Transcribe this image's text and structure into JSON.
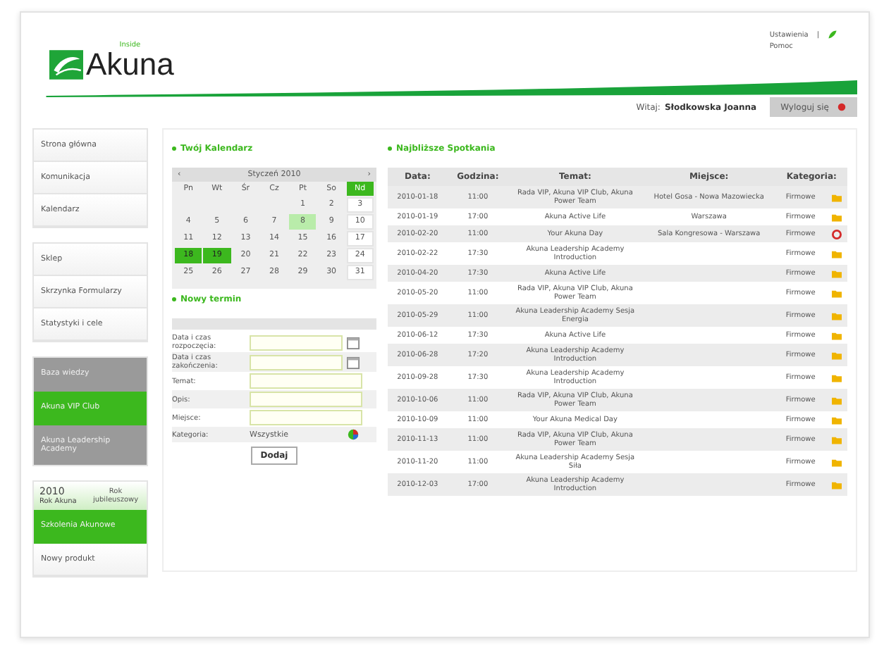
{
  "header": {
    "logo_small": "Inside",
    "logo": "Akuna",
    "links": [
      "Ustawienia",
      "|",
      "Pomoc"
    ],
    "welcome_label": "Witaj:",
    "user": "Słodkowska Joanna",
    "logout": "Wyloguj się"
  },
  "sidebar": {
    "groups": [
      {
        "kind": "plain",
        "items": [
          "Strona główna",
          "Komunikacja",
          "Kalendarz"
        ]
      },
      {
        "kind": "plain",
        "items": [
          "Sklep",
          "Skrzynka Formularzy",
          "Statystyki i cele"
        ]
      },
      {
        "kind": "tiles",
        "items": [
          {
            "label": "Baza wiedzy",
            "color": "#9a9a9a"
          },
          {
            "label": "Akuna VIP Club",
            "color": "#3cb81e"
          },
          {
            "label": "Akuna Leadership Academy",
            "color": "#9a9a9a"
          }
        ]
      }
    ],
    "banner": {
      "year": "2010",
      "brand": "Rok Akuna",
      "text": "Rok jubileuszowy"
    },
    "promo": "Szkolenia Akunowe",
    "last_item": "Nowy produkt"
  },
  "calendar": {
    "title": "Twój Kalendarz",
    "month": "Styczeń 2010",
    "prev": "‹",
    "next": "›",
    "weekdays": [
      {
        "label": "Pn",
        "selected": false
      },
      {
        "label": "Wt",
        "selected": false
      },
      {
        "label": "Śr",
        "selected": false
      },
      {
        "label": "Cz",
        "selected": false
      },
      {
        "label": "Pt",
        "selected": false
      },
      {
        "label": "So",
        "selected": false
      },
      {
        "label": "Nd",
        "selected": true
      }
    ],
    "weeks": [
      [
        {
          "kind": "empty"
        },
        {
          "kind": "empty"
        },
        {
          "kind": "empty"
        },
        {
          "kind": "empty"
        },
        {
          "day": "1",
          "kind": "day"
        },
        {
          "day": "2",
          "kind": "day"
        },
        {
          "day": "3",
          "kind": "sunday"
        }
      ],
      [
        {
          "day": "4",
          "kind": "day"
        },
        {
          "day": "5",
          "kind": "day"
        },
        {
          "day": "6",
          "kind": "day"
        },
        {
          "day": "7",
          "kind": "day"
        },
        {
          "day": "8",
          "kind": "today"
        },
        {
          "day": "9",
          "kind": "day"
        },
        {
          "day": "10",
          "kind": "sunday"
        }
      ],
      [
        {
          "day": "11",
          "kind": "day"
        },
        {
          "day": "12",
          "kind": "day"
        },
        {
          "day": "13",
          "kind": "day"
        },
        {
          "day": "14",
          "kind": "day"
        },
        {
          "day": "15",
          "kind": "day"
        },
        {
          "day": "16",
          "kind": "day"
        },
        {
          "day": "17",
          "kind": "sunday"
        }
      ],
      [
        {
          "day": "18",
          "kind": "event"
        },
        {
          "day": "19",
          "kind": "event"
        },
        {
          "day": "20",
          "kind": "day"
        },
        {
          "day": "21",
          "kind": "day"
        },
        {
          "day": "22",
          "kind": "day"
        },
        {
          "day": "23",
          "kind": "day"
        },
        {
          "day": "24",
          "kind": "sunday"
        }
      ],
      [
        {
          "day": "25",
          "kind": "day"
        },
        {
          "day": "26",
          "kind": "day"
        },
        {
          "day": "27",
          "kind": "day"
        },
        {
          "day": "28",
          "kind": "day"
        },
        {
          "day": "29",
          "kind": "day"
        },
        {
          "day": "30",
          "kind": "day"
        },
        {
          "day": "31",
          "kind": "sunday"
        }
      ]
    ]
  },
  "new_event": {
    "title": "Nowy termin",
    "fields": [
      {
        "label": "Data i czas rozpoczęcia:",
        "kind": "date"
      },
      {
        "label": "Data i czas zakończenia:",
        "kind": "date"
      },
      {
        "label": "Temat:",
        "kind": "text"
      },
      {
        "label": "Opis:",
        "kind": "text"
      },
      {
        "label": "Miejsce:",
        "kind": "text"
      },
      {
        "label": "Kategoria:",
        "kind": "select",
        "value": "Wszystkie"
      }
    ],
    "submit": "Dodaj"
  },
  "meetings": {
    "title": "Najbliższe Spotkania",
    "columns": [
      "Data:",
      "Godzina:",
      "Temat:",
      "Miejsce:",
      "Kategoria:"
    ],
    "rows": [
      {
        "date": "2010-01-18",
        "time": "11:00",
        "topic": "Rada VIP, Akuna VIP Club, Akuna Power Team",
        "place": "Hotel Gosa - Nowa Mazowiecka",
        "category": "Firmowe",
        "kind": "regular"
      },
      {
        "date": "2010-01-19",
        "time": "17:00",
        "topic": "Akuna Active Life",
        "place": "Warszawa",
        "category": "Firmowe",
        "kind": "regular"
      },
      {
        "date": "2010-02-20",
        "time": "11:00",
        "topic": "Your Akuna Day",
        "place": "Sala Kongresowa - Warszawa",
        "category": "Firmowe",
        "kind": "cancelled"
      },
      {
        "date": "2010-02-22",
        "time": "17:30",
        "topic": "Akuna Leadership Academy Introduction",
        "category": "Firmowe",
        "kind": "regular"
      },
      {
        "date": "2010-04-20",
        "time": "17:30",
        "topic": "Akuna Active Life",
        "category": "Firmowe",
        "kind": "regular"
      },
      {
        "date": "2010-05-20",
        "time": "11:00",
        "topic": "Rada VIP, Akuna VIP Club, Akuna Power Team",
        "category": "Firmowe",
        "kind": "regular"
      },
      {
        "date": "2010-05-29",
        "time": "11:00",
        "topic": "Akuna Leadership Academy Sesja Energia",
        "category": "Firmowe",
        "kind": "regular"
      },
      {
        "date": "2010-06-12",
        "time": "17:30",
        "topic": "Akuna Active Life",
        "category": "Firmowe",
        "kind": "regular"
      },
      {
        "date": "2010-06-28",
        "time": "17:20",
        "topic": "Akuna Leadership Academy Introduction",
        "category": "Firmowe",
        "kind": "regular"
      },
      {
        "date": "2010-09-28",
        "time": "17:30",
        "topic": "Akuna Leadership Academy Introduction",
        "category": "Firmowe",
        "kind": "regular"
      },
      {
        "date": "2010-10-06",
        "time": "11:00",
        "topic": "Rada VIP, Akuna VIP Club, Akuna Power Team",
        "category": "Firmowe",
        "kind": "regular"
      },
      {
        "date": "2010-10-09",
        "time": "11:00",
        "topic": "Your Akuna Medical Day",
        "category": "Firmowe",
        "kind": "regular"
      },
      {
        "date": "2010-11-13",
        "time": "11:00",
        "topic": "Rada VIP, Akuna VIP Club, Akuna Power Team",
        "category": "Firmowe",
        "kind": "regular"
      },
      {
        "date": "2010-11-20",
        "time": "11:00",
        "topic": "Akuna Leadership Academy Sesja Siła",
        "category": "Firmowe",
        "kind": "regular"
      },
      {
        "date": "2010-12-03",
        "time": "17:00",
        "topic": "Akuna Leadership Academy Introduction",
        "category": "Firmowe",
        "kind": "regular"
      }
    ]
  }
}
